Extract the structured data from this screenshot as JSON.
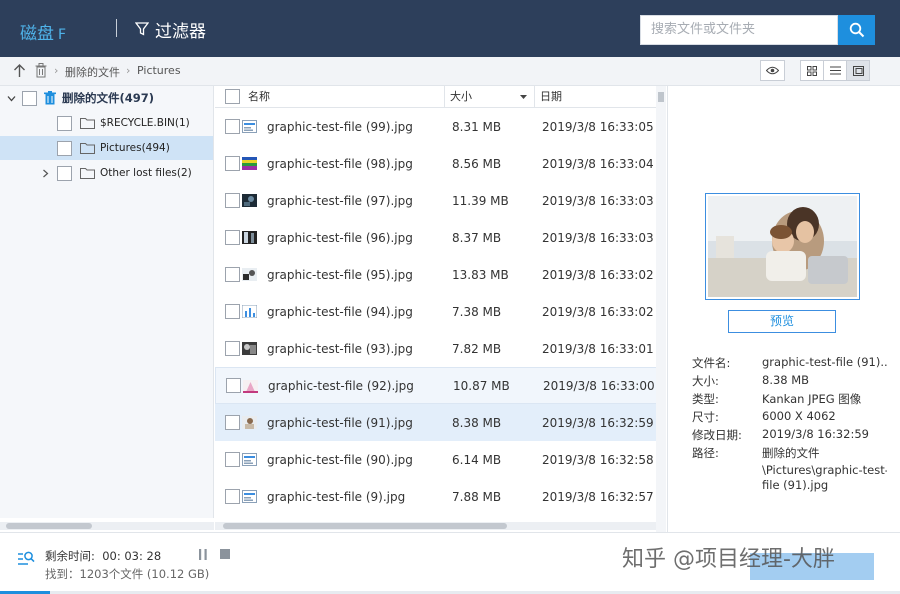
{
  "topbar": {
    "disk_label": "磁盘",
    "disk_letter": "F",
    "filter_label": "过滤器",
    "search_placeholder": "搜索文件或文件夹"
  },
  "breadcrumb": {
    "items": [
      "删除的文件",
      "Pictures"
    ]
  },
  "tree": {
    "root": "删除的文件(497)",
    "items": [
      "$RECYCLE.BIN(1)",
      "Pictures(494)",
      "Other lost files(2)"
    ]
  },
  "list": {
    "columns": {
      "name": "名称",
      "size": "大小",
      "date": "日期"
    },
    "rows": [
      {
        "name": "graphic-test-file (99).jpg",
        "size": "8.31 MB",
        "date": "2019/3/8 16:33:05",
        "thumb": "doc"
      },
      {
        "name": "graphic-test-file (98).jpg",
        "size": "8.56 MB",
        "date": "2019/3/8 16:33:04",
        "thumb": "bars"
      },
      {
        "name": "graphic-test-file (97).jpg",
        "size": "11.39 MB",
        "date": "2019/3/8 16:33:03",
        "thumb": "dark"
      },
      {
        "name": "graphic-test-file (96).jpg",
        "size": "8.37 MB",
        "date": "2019/3/8 16:33:03",
        "thumb": "dark2"
      },
      {
        "name": "graphic-test-file (95).jpg",
        "size": "13.83 MB",
        "date": "2019/3/8 16:33:02",
        "thumb": "mixed"
      },
      {
        "name": "graphic-test-file (94).jpg",
        "size": "7.38 MB",
        "date": "2019/3/8 16:33:02",
        "thumb": "chart"
      },
      {
        "name": "graphic-test-file (93).jpg",
        "size": "7.82 MB",
        "date": "2019/3/8 16:33:01",
        "thumb": "dark3"
      },
      {
        "name": "graphic-test-file (92).jpg",
        "size": "10.87 MB",
        "date": "2019/3/8 16:33:00",
        "thumb": "pink"
      },
      {
        "name": "graphic-test-file (91).jpg",
        "size": "8.38 MB",
        "date": "2019/3/8 16:32:59",
        "thumb": "person"
      },
      {
        "name": "graphic-test-file (90).jpg",
        "size": "6.14 MB",
        "date": "2019/3/8 16:32:58",
        "thumb": "doc"
      },
      {
        "name": "graphic-test-file (9).jpg",
        "size": "7.88 MB",
        "date": "2019/3/8 16:32:57",
        "thumb": "doc"
      }
    ]
  },
  "preview": {
    "button": "预览",
    "fields": [
      {
        "key": "文件名:",
        "value": "graphic-test-file (91)...."
      },
      {
        "key": "大小:",
        "value": "8.38 MB"
      },
      {
        "key": "类型:",
        "value": "Kankan JPEG 图像"
      },
      {
        "key": "尺寸:",
        "value": "6000 X 4062"
      },
      {
        "key": "修改日期:",
        "value": "2019/3/8 16:32:59"
      },
      {
        "key": "路径:",
        "value": "删除的文件"
      }
    ],
    "path_extra": [
      "\\Pictures\\graphic-test-",
      "file (91).jpg"
    ]
  },
  "status": {
    "remaining_label": "剩余时间:",
    "remaining_value": "00: 03: 28",
    "found": "找到：1203个文件 (10.12 GB)",
    "progress": 0.055
  },
  "watermark": "知乎 @项目经理-大胖",
  "colors": {
    "topbar": "#2d3f5b",
    "accent": "#1e8fde",
    "selected": "#cfe3f6"
  }
}
